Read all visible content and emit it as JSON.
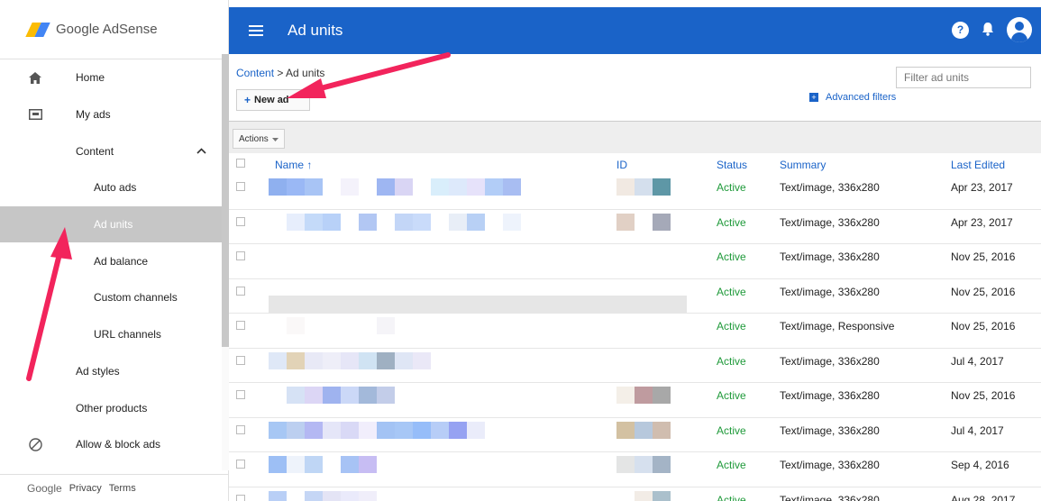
{
  "app": {
    "logo_text": "Google AdSense",
    "accent": "#1a63c8",
    "status_color": "#1f9a3a"
  },
  "sidebar": {
    "items": [
      {
        "label": "Home",
        "icon": "home-icon"
      },
      {
        "label": "My ads",
        "icon": "my-ads-icon"
      },
      {
        "label": "Content",
        "icon": "",
        "chevron": "^"
      },
      {
        "label": "Auto ads"
      },
      {
        "label": "Ad units",
        "active": true
      },
      {
        "label": "Ad balance"
      },
      {
        "label": "Custom channels"
      },
      {
        "label": "URL channels"
      },
      {
        "label": "Ad styles"
      },
      {
        "label": "Other products"
      },
      {
        "label": "Allow & block ads",
        "icon": "block-icon"
      }
    ],
    "footer": {
      "brand": "Google",
      "privacy": "Privacy",
      "terms": "Terms"
    }
  },
  "appbar": {
    "title": "Ad units",
    "help": "?"
  },
  "main": {
    "breadcrumb_link": "Content",
    "breadcrumb_sep": " > ",
    "breadcrumb_current": "Ad units",
    "new_button": "New ad",
    "filter_placeholder": "Filter ad units",
    "advanced_filters": "Advanced filters",
    "actions": "Actions"
  },
  "table": {
    "columns": {
      "name": "Name ↑",
      "id": "ID",
      "status": "Status",
      "summary": "Summary",
      "edited": "Last Edited"
    },
    "rows": [
      {
        "status": "Active",
        "summary": "Text/image, 336x280",
        "edited": "Apr 23, 2017"
      },
      {
        "status": "Active",
        "summary": "Text/image, 336x280",
        "edited": "Apr 23, 2017"
      },
      {
        "status": "Active",
        "summary": "Text/image, 336x280",
        "edited": "Nov 25, 2016"
      },
      {
        "status": "Active",
        "summary": "Text/image, 336x280",
        "edited": "Nov 25, 2016"
      },
      {
        "status": "Active",
        "summary": "Text/image, Responsive",
        "edited": "Nov 25, 2016"
      },
      {
        "status": "Active",
        "summary": "Text/image, 336x280",
        "edited": "Jul 4, 2017"
      },
      {
        "status": "Active",
        "summary": "Text/image, 336x280",
        "edited": "Nov 25, 2016"
      },
      {
        "status": "Active",
        "summary": "Text/image, 336x280",
        "edited": "Jul 4, 2017"
      },
      {
        "status": "Active",
        "summary": "Text/image, 336x280",
        "edited": "Sep 4, 2016"
      },
      {
        "status": "Active",
        "summary": "Text/image, 336x280",
        "edited": "Aug 28, 2017"
      }
    ]
  },
  "annotation": {
    "arrow_color": "#f2245c"
  }
}
